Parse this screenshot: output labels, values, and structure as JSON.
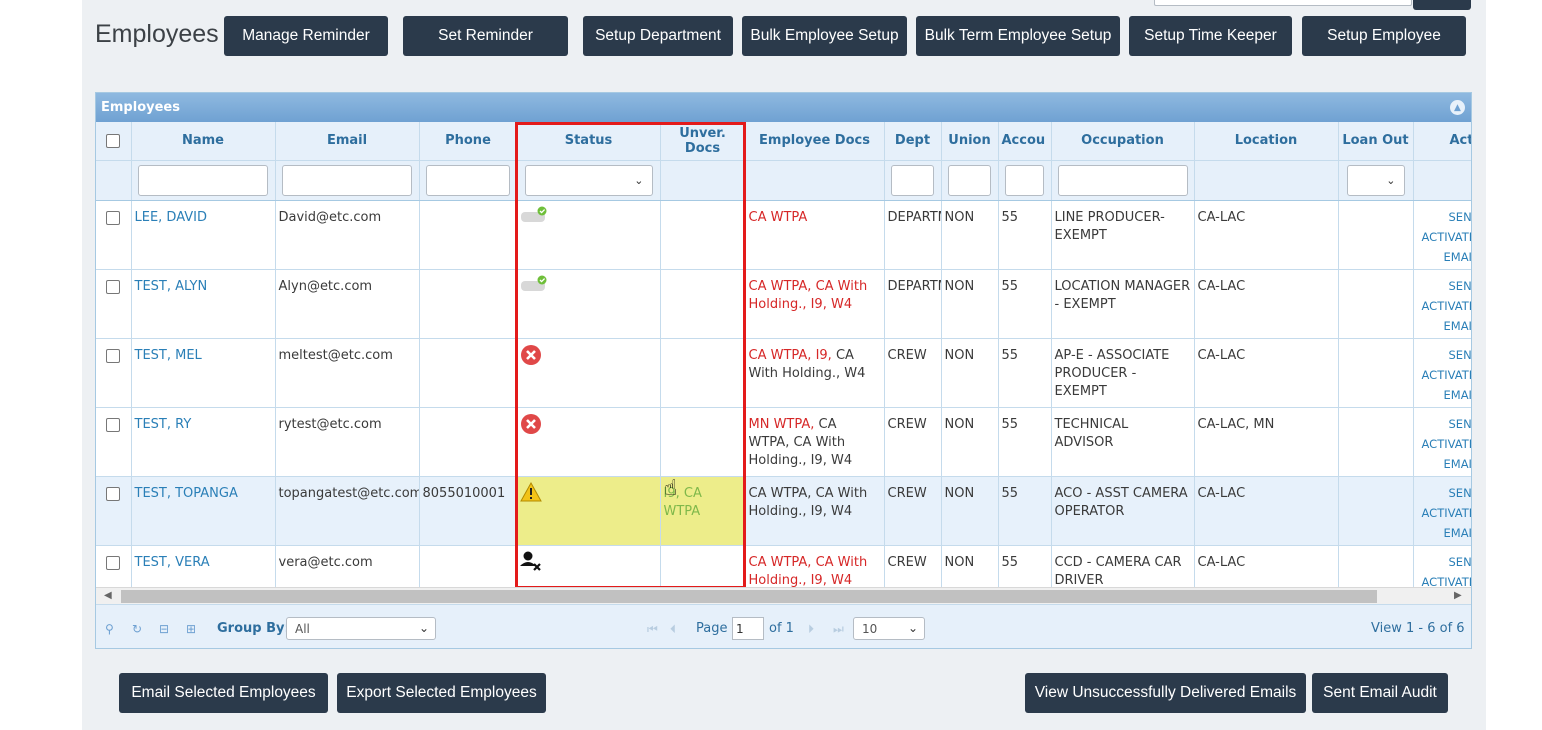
{
  "header": {
    "title": "Employees",
    "buttons": [
      "Manage Reminder",
      "Set Reminder",
      "Setup Department",
      "Bulk Employee Setup",
      "Bulk Term Employee Setup",
      "Setup Time Keeper",
      "Setup Employee"
    ]
  },
  "grid": {
    "caption": "Employees",
    "columns": {
      "name": "Name",
      "email": "Email",
      "phone": "Phone",
      "status": "Status",
      "unver_docs": "Unver. Docs",
      "employee_docs": "Employee Docs",
      "dept": "Dept",
      "union": "Union",
      "account": "Accou",
      "occupation": "Occupation",
      "location": "Location",
      "loan_out": "Loan Out",
      "actions": "Action"
    },
    "rows": [
      {
        "name": "LEE, DAVID",
        "email": "David@etc.com",
        "phone": "",
        "status": "active-toggle",
        "unver_docs": "",
        "docs_red": "CA WTPA",
        "docs_plain": "",
        "dept": "DEPARTME",
        "union": "NON",
        "account": "55",
        "occupation": "LINE PRODUCER-EXEMPT",
        "location": "CA-LAC"
      },
      {
        "name": "TEST, ALYN",
        "email": "Alyn@etc.com",
        "phone": "",
        "status": "active-toggle",
        "unver_docs": "",
        "docs_red": "CA WTPA, CA With Holding., I9, W4",
        "docs_plain": "",
        "dept": "DEPARTME",
        "union": "NON",
        "account": "55",
        "occupation": "LOCATION MANAGER - EXEMPT",
        "location": "CA-LAC"
      },
      {
        "name": "TEST, MEL",
        "email": "meltest@etc.com",
        "phone": "",
        "status": "error",
        "unver_docs": "",
        "docs_red": "CA WTPA, I9,",
        "docs_plain": " CA With Holding., W4",
        "dept": "CREW",
        "union": "NON",
        "account": "55",
        "occupation": "AP-E - ASSOCIATE PRODUCER - EXEMPT",
        "location": "CA-LAC"
      },
      {
        "name": "TEST, RY",
        "email": "rytest@etc.com",
        "phone": "",
        "status": "error",
        "unver_docs": "",
        "docs_red": "MN WTPA,",
        "docs_plain": " CA WTPA, CA With Holding., I9, W4",
        "dept": "CREW",
        "union": "NON",
        "account": "55",
        "occupation": "TECHNICAL ADVISOR",
        "location": "CA-LAC, MN"
      },
      {
        "name": "TEST, TOPANGA",
        "email": "topangatest@etc.com",
        "phone": "8055010001",
        "status": "warning",
        "unver_docs": "I9, CA WTPA",
        "docs_red": "",
        "docs_plain": "CA WTPA, CA With Holding., I9, W4",
        "dept": "CREW",
        "union": "NON",
        "account": "55",
        "occupation": "ACO - ASST CAMERA OPERATOR",
        "location": "CA-LAC"
      },
      {
        "name": "TEST, VERA",
        "email": "vera@etc.com",
        "phone": "",
        "status": "user-removed",
        "unver_docs": "",
        "docs_red": "CA WTPA, CA With Holding., I9, W4",
        "docs_plain": "",
        "dept": "CREW",
        "union": "NON",
        "account": "55",
        "occupation": "CCD - CAMERA CAR DRIVER",
        "location": "CA-LAC"
      }
    ],
    "action_lines": [
      "SEND",
      "ACTIVATI",
      "EMAIL"
    ]
  },
  "pager": {
    "group_by_label": "Group By:",
    "group_by_value": "All",
    "page_label": "Page",
    "page_value": "1",
    "of_label": "of 1",
    "page_size": "10",
    "view_text": "View 1 - 6 of 6"
  },
  "footer": {
    "email_selected": "Email Selected Employees",
    "export_selected": "Export Selected Employees",
    "view_unsuccessful": "View Unsuccessfully Delivered Emails",
    "sent_audit": "Sent Email Audit"
  },
  "colors": {
    "button_bg": "#2b3a4b",
    "header_text": "#2e6e9e",
    "link": "#2a7fb7",
    "doc_red": "#d62727",
    "highlight_frame": "#e31a1a",
    "unverified_bg": "#eded8a"
  }
}
